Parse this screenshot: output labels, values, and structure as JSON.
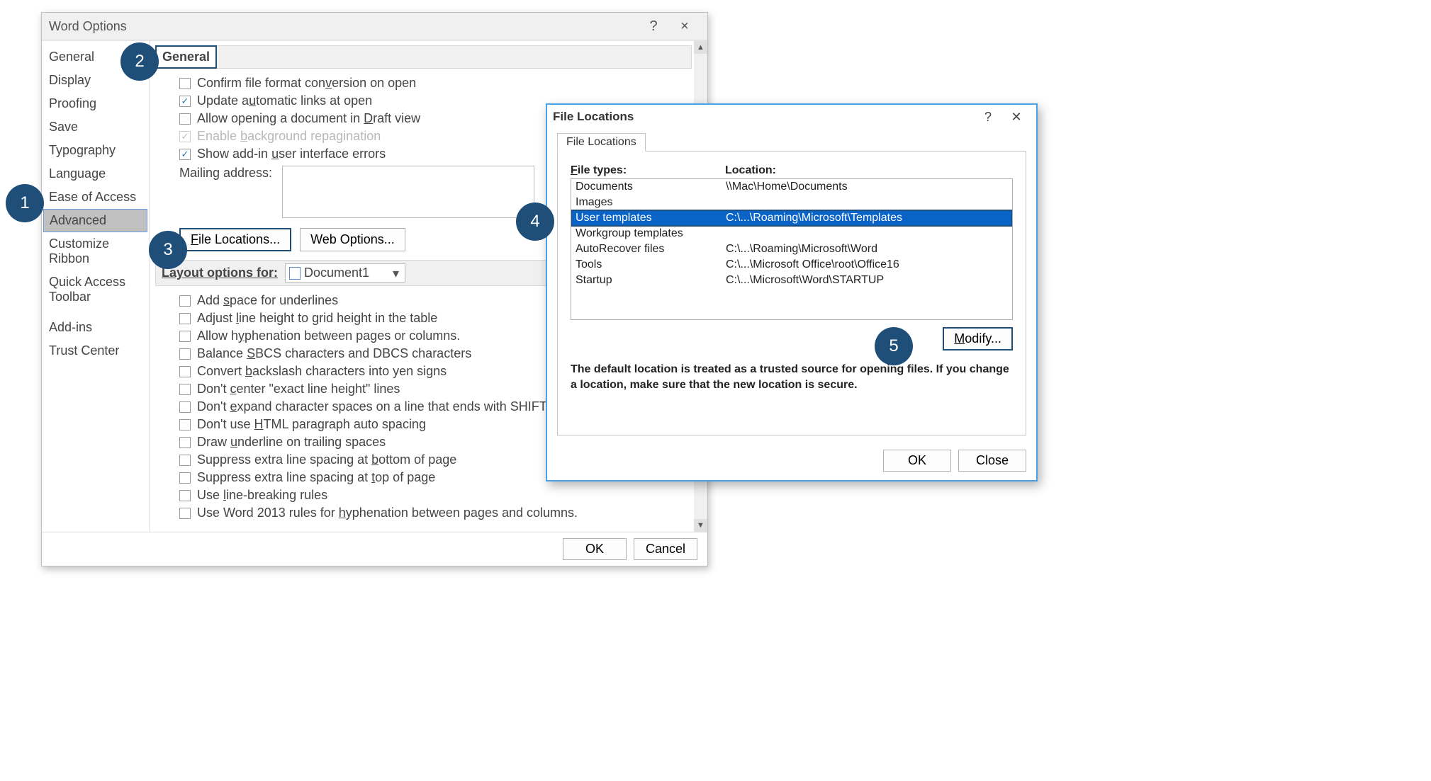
{
  "callouts": {
    "1": "1",
    "2": "2",
    "3": "3",
    "4": "4",
    "5": "5"
  },
  "word_options": {
    "title": "Word Options",
    "help_tooltip": "?",
    "close_tooltip": "×",
    "sidebar": {
      "items": [
        "General",
        "Display",
        "Proofing",
        "Save",
        "Typography",
        "Language",
        "Ease of Access",
        "Advanced",
        "Customize Ribbon",
        "Quick Access Toolbar",
        "Add-ins",
        "Trust Center"
      ],
      "selected_index": 7
    },
    "general_section": {
      "header": "General",
      "confirm_open": {
        "label_pre": "Confirm file format con",
        "u": "v",
        "label_post": "ersion on open",
        "checked": false
      },
      "update_links": {
        "label_pre": "Update a",
        "u": "u",
        "label_post": "tomatic links at open",
        "checked": true
      },
      "allow_draft": {
        "label_pre": "Allow opening a document in ",
        "u": "D",
        "label_post": "raft view",
        "checked": false
      },
      "enable_bg": {
        "label_pre": "Enable ",
        "u": "b",
        "label_post": "ackground repagination",
        "checked": true,
        "disabled": true
      },
      "show_addin": {
        "label_pre": "Show add-in ",
        "u": "u",
        "label_post": "ser interface errors",
        "checked": true
      },
      "mailing_label": "Mailing address:",
      "mailing_value": ""
    },
    "buttons": {
      "file_locations": "File Locations...",
      "web_options": "Web Options..."
    },
    "layout_section": {
      "label": "Layout options for:",
      "document": "Document1",
      "opts": [
        {
          "pre": "Add ",
          "u": "s",
          "post": "pace for underlines"
        },
        {
          "pre": "Adjust ",
          "u": "l",
          "post": "ine height to grid height in the table"
        },
        {
          "pre": "Allow h",
          "u": "y",
          "post": "phenation between pages or columns."
        },
        {
          "pre": "Balance ",
          "u": "S",
          "post": "BCS characters and DBCS characters"
        },
        {
          "pre": "Convert ",
          "u": "b",
          "post": "ackslash characters into yen signs"
        },
        {
          "pre": "Don't ",
          "u": "c",
          "post": "enter \"exact line height\" lines"
        },
        {
          "pre": "Don't ",
          "u": "e",
          "post": "xpand character spaces on a line that ends with SHIFT+RETURN"
        },
        {
          "pre": "Don't use ",
          "u": "H",
          "post": "TML paragraph auto spacing"
        },
        {
          "pre": "Draw ",
          "u": "u",
          "post": "nderline on trailing spaces"
        },
        {
          "pre": "Suppress extra line spacing at ",
          "u": "b",
          "post": "ottom of page"
        },
        {
          "pre": "Suppress extra line spacing at ",
          "u": "t",
          "post": "op of page"
        },
        {
          "pre": "Use ",
          "u": "l",
          "post": "ine-breaking rules"
        },
        {
          "pre": "Use Word 2013 rules for ",
          "u": "h",
          "post": "yphenation between pages and columns."
        }
      ]
    },
    "footer": {
      "ok": "OK",
      "cancel": "Cancel"
    }
  },
  "file_locations": {
    "title": "File Locations",
    "tab_label": "File Locations",
    "col_types": "File types:",
    "col_location": "Location:",
    "rows": [
      {
        "type": "Documents",
        "loc": "\\\\Mac\\Home\\Documents"
      },
      {
        "type": "Images",
        "loc": ""
      },
      {
        "type": "User templates",
        "loc": "C:\\...\\Roaming\\Microsoft\\Templates",
        "selected": true
      },
      {
        "type": "Workgroup templates",
        "loc": ""
      },
      {
        "type": "AutoRecover files",
        "loc": "C:\\...\\Roaming\\Microsoft\\Word"
      },
      {
        "type": "Tools",
        "loc": "C:\\...\\Microsoft Office\\root\\Office16"
      },
      {
        "type": "Startup",
        "loc": "C:\\...\\Microsoft\\Word\\STARTUP"
      }
    ],
    "modify": "Modify...",
    "note": "The default location is treated as a trusted source for opening files. If you change a location, make sure that the new location is secure.",
    "footer": {
      "ok": "OK",
      "close": "Close"
    }
  }
}
